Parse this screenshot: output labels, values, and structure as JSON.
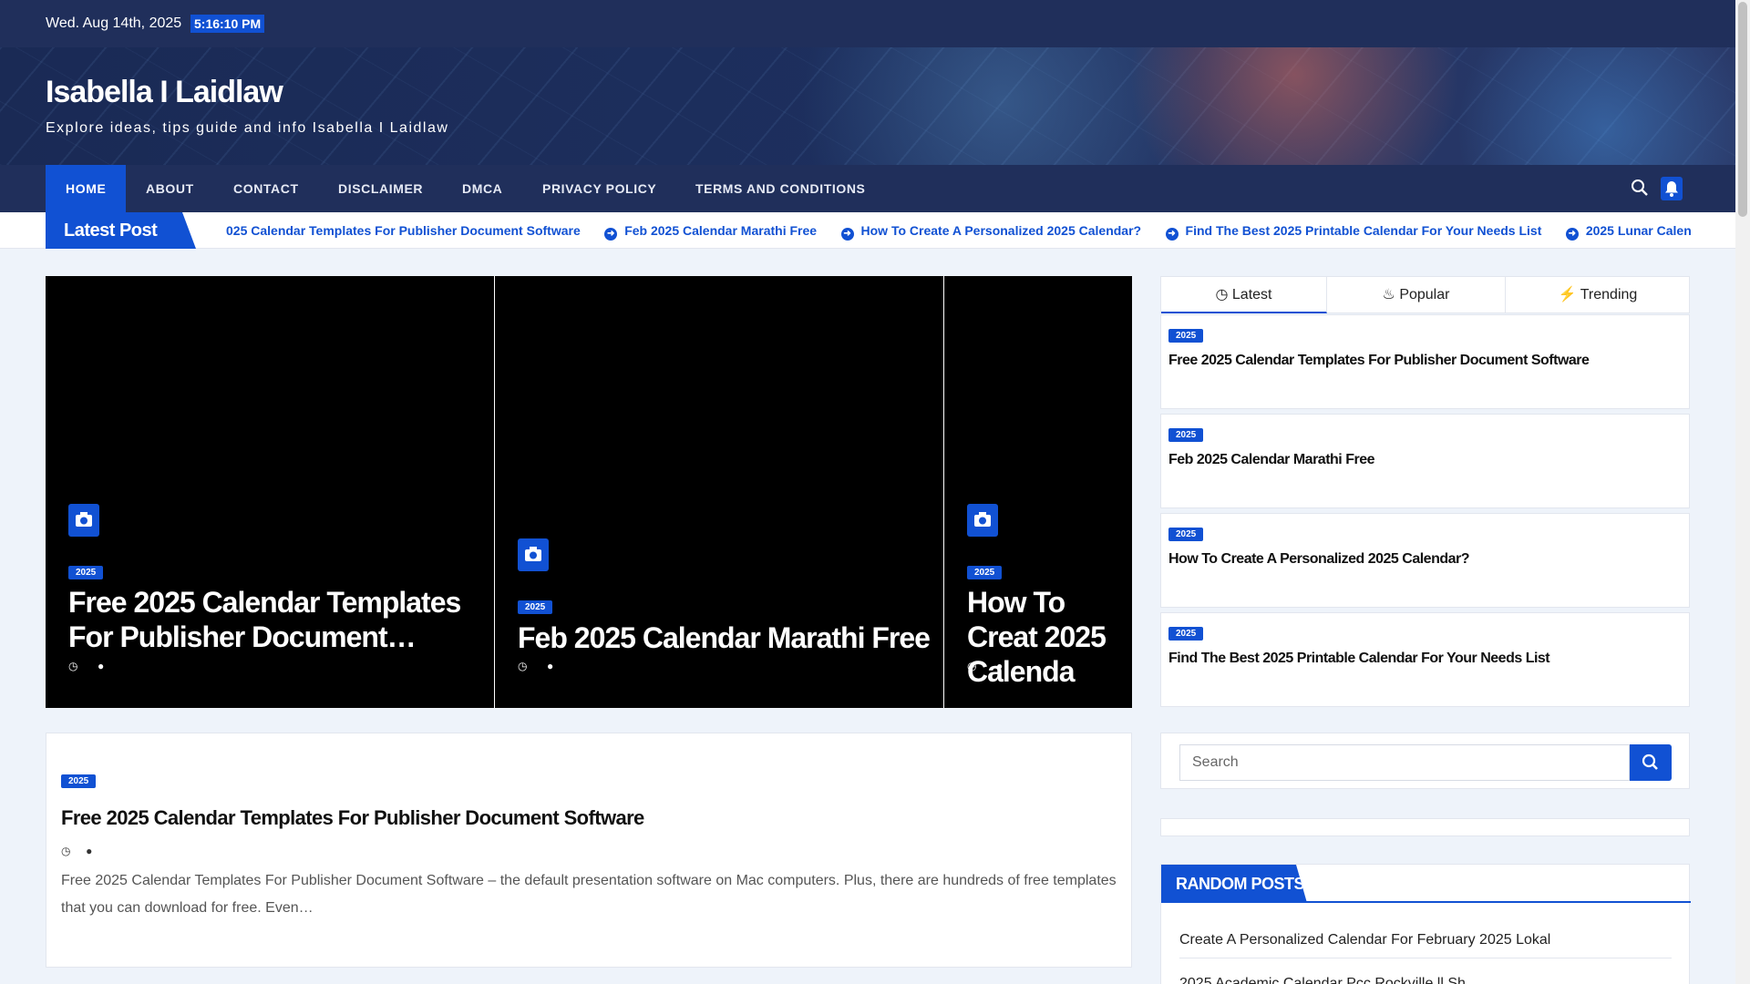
{
  "topbar": {
    "date": "Wed. Aug 14th, 2025",
    "time": "5:16:10 PM"
  },
  "site": {
    "title": "Isabella I Laidlaw",
    "tagline": "Explore ideas, tips guide and info Isabella I Laidlaw"
  },
  "nav": {
    "items": [
      "HOME",
      "ABOUT",
      "CONTACT",
      "DISCLAIMER",
      "DMCA",
      "PRIVACY POLICY",
      "TERMS AND CONDITIONS"
    ],
    "active": "HOME"
  },
  "ticker": {
    "label": "Latest Post",
    "items": [
      "025 Calendar Templates For Publisher Document Software",
      "Feb 2025 Calendar Marathi Free",
      "How To Create A Personalized 2025 Calendar?",
      "Find The Best 2025 Printable Calendar For Your Needs List",
      "2025 Lunar Calend"
    ]
  },
  "slides": [
    {
      "category": "2025",
      "title": "Free 2025 Calendar Templates For Publisher Document…"
    },
    {
      "category": "2025",
      "title": "Feb 2025 Calendar Marathi Free"
    },
    {
      "category": "2025",
      "title": "How To Creat 2025 Calenda"
    }
  ],
  "featured": {
    "category": "2025",
    "title": "Free 2025 Calendar Templates For Publisher Document Software",
    "excerpt": "Free 2025 Calendar Templates For Publisher Document Software – the default presentation software on Mac computers. Plus, there are hundreds of free templates that you can download for free. Even…"
  },
  "sidebar": {
    "tabs": [
      "Latest",
      "Popular",
      "Trending"
    ],
    "active_tab": "Latest",
    "posts": [
      {
        "category": "2025",
        "title": "Free 2025 Calendar Templates For Publisher Document Software"
      },
      {
        "category": "2025",
        "title": "Feb 2025 Calendar Marathi Free"
      },
      {
        "category": "2025",
        "title": "How To Create A Personalized 2025 Calendar?"
      },
      {
        "category": "2025",
        "title": "Find The Best 2025 Printable Calendar For Your Needs List"
      }
    ],
    "search_placeholder": "Search",
    "random_title": "RANDOM POSTS",
    "random_items": [
      "Create A Personalized Calendar For February 2025 Lokal",
      "2025 Academic Calendar Pcc Rockville ll Sh"
    ]
  },
  "colors": {
    "accent": "#1151d3",
    "nav_bg": "#202f5b",
    "page_bg": "#eef3fa"
  }
}
